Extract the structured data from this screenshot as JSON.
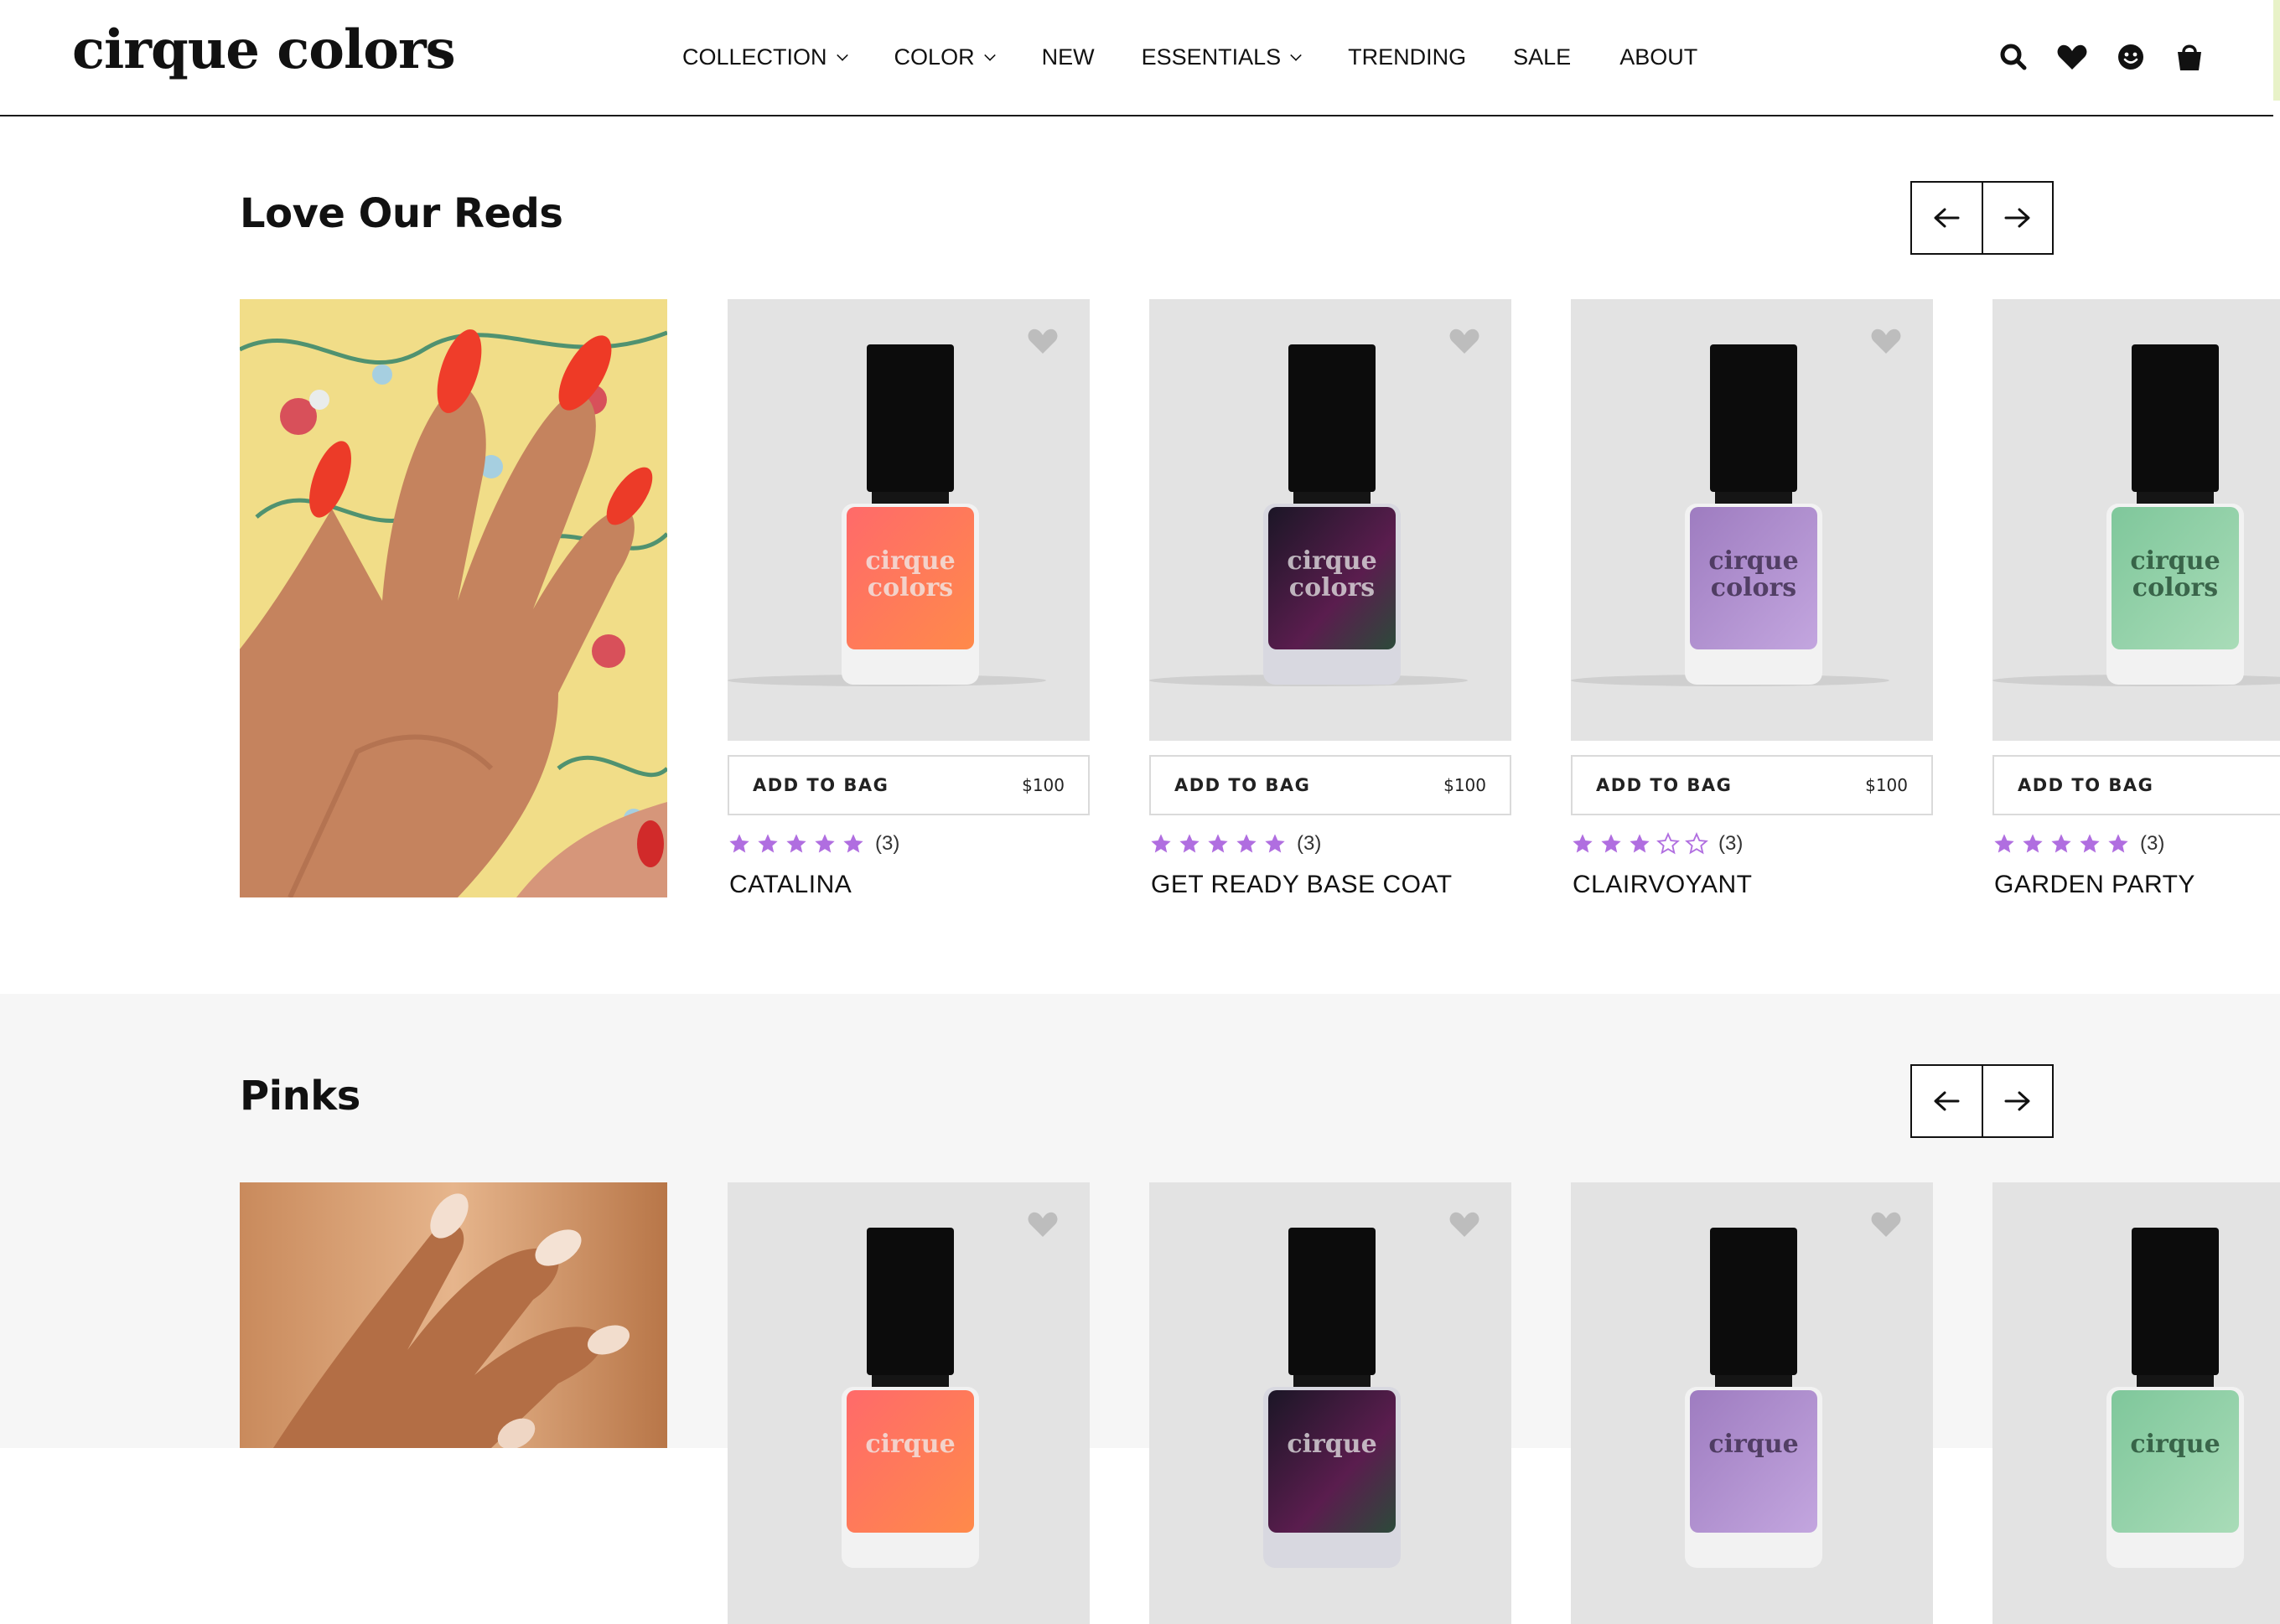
{
  "brand": {
    "name": "cirque colors"
  },
  "nav": [
    {
      "label": "COLLECTION",
      "dropdown": true
    },
    {
      "label": "COLOR",
      "dropdown": true
    },
    {
      "label": "NEW",
      "dropdown": false
    },
    {
      "label": "ESSENTIALS",
      "dropdown": true
    },
    {
      "label": "TRENDING",
      "dropdown": false
    },
    {
      "label": "SALE",
      "dropdown": false
    },
    {
      "label": "ABOUT",
      "dropdown": false
    }
  ],
  "header_icons": [
    "search-icon",
    "heart-icon",
    "account-icon",
    "bag-icon"
  ],
  "colors": {
    "star": "#b06ee0",
    "star_empty": "#b06ee0",
    "card_bg": "#e3e3e3",
    "section_alt_bg": "#f6f6f6"
  },
  "sections": [
    {
      "title": "Love Our Reds",
      "hero_image": "red-nails-floral-photo",
      "products": [
        {
          "name": "CATALINA",
          "add_label": "ADD TO BAG",
          "price": "$100",
          "rating": 5,
          "reviews": "(3)",
          "polish": [
            "#ff6a6a",
            "#ff8a4a"
          ]
        },
        {
          "name": "GET READY BASE COAT",
          "add_label": "ADD TO BAG",
          "price": "$100",
          "rating": 5,
          "reviews": "(3)",
          "polish": [
            "#1b1626",
            "#5a1d4e"
          ]
        },
        {
          "name": "CLAIRVOYANT",
          "add_label": "ADD TO BAG",
          "price": "$100",
          "rating": 3,
          "reviews": "(3)",
          "polish": [
            "#9e7cc0",
            "#c3a6df"
          ]
        },
        {
          "name": "GARDEN PARTY",
          "add_label": "ADD TO BAG",
          "price": "",
          "rating": 5,
          "reviews": "(3)",
          "polish": [
            "#7fc79b",
            "#a9dcb8"
          ]
        }
      ]
    },
    {
      "title": "Pinks",
      "hero_image": "nude-nails-photo",
      "products": [
        {
          "polish": [
            "#ff6a6a",
            "#ff8a4a"
          ]
        },
        {
          "polish": [
            "#1b1626",
            "#5a1d4e"
          ]
        },
        {
          "polish": [
            "#9e7cc0",
            "#c3a6df"
          ]
        },
        {
          "polish": [
            "#7fc79b",
            "#a9dcb8"
          ]
        }
      ]
    }
  ]
}
